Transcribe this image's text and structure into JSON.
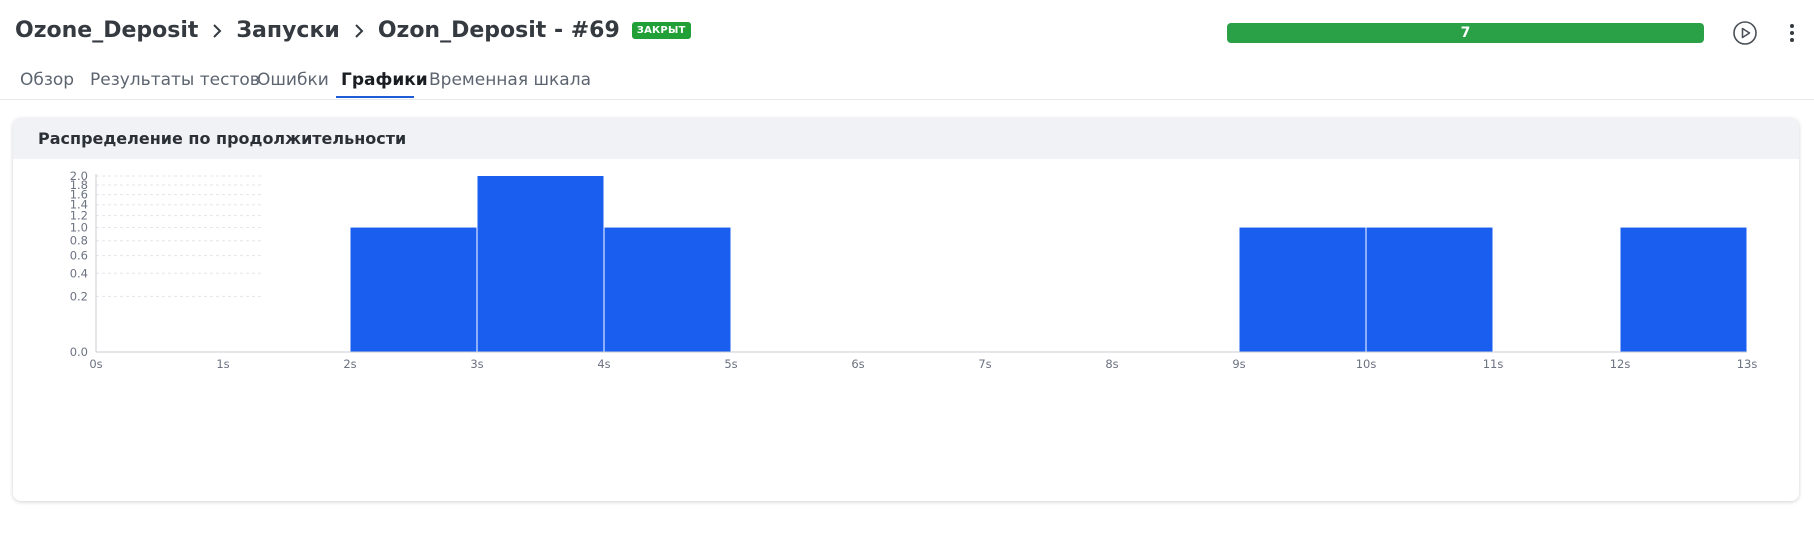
{
  "breadcrumb": {
    "project": "Ozone_Deposit",
    "section": "Запуски",
    "run": "Ozon_Deposit - #69",
    "status_badge": "ЗАКРЫТ"
  },
  "progress": {
    "label": "7",
    "fraction": 1.0,
    "color": "#2aa146"
  },
  "icons": {
    "run": "play-circle-icon",
    "menu": "more-vertical-icon",
    "separator": "chevron-right-icon"
  },
  "tabs": [
    {
      "label": "Обзор",
      "active": false
    },
    {
      "label": "Результаты тестов",
      "active": false
    },
    {
      "label": "Ошибки",
      "active": false
    },
    {
      "label": "Графики",
      "active": true
    },
    {
      "label": "Временная шкала",
      "active": false
    }
  ],
  "card": {
    "title": "Распределение по продолжительности"
  },
  "chart_data": {
    "type": "bar",
    "title": "Распределение по продолжительности",
    "xlabel": "",
    "ylabel": "",
    "x_ticks": [
      "0s",
      "1s",
      "2s",
      "3s",
      "4s",
      "5s",
      "6s",
      "7s",
      "8s",
      "9s",
      "10s",
      "11s",
      "12s",
      "13s"
    ],
    "y_ticks": [
      "0.0",
      "0.2",
      "0.4",
      "0.6",
      "0.8",
      "1.0",
      "1.2",
      "1.4",
      "1.6",
      "1.8",
      "2.0"
    ],
    "ylim": [
      0,
      2
    ],
    "y_scale": "sqrt",
    "grid": true,
    "bar_color": "#1a5ef0",
    "bins": [
      {
        "start": 2,
        "end": 3,
        "value": 1
      },
      {
        "start": 3,
        "end": 4,
        "value": 2
      },
      {
        "start": 4,
        "end": 5,
        "value": 1
      },
      {
        "start": 9,
        "end": 10,
        "value": 1
      },
      {
        "start": 10,
        "end": 11,
        "value": 1
      },
      {
        "start": 12,
        "end": 13,
        "value": 1
      }
    ]
  }
}
